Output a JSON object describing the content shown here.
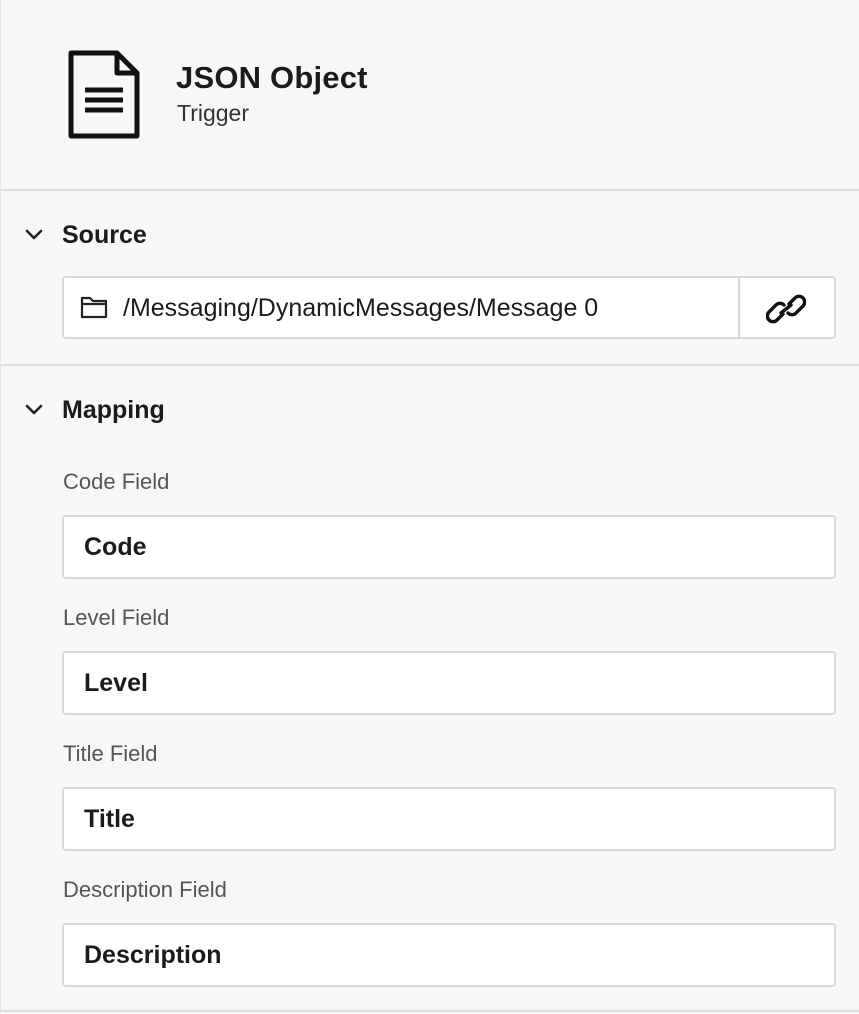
{
  "header": {
    "title": "JSON Object",
    "subtitle": "Trigger",
    "icon": "document-icon"
  },
  "source": {
    "label": "Source",
    "path": "/Messaging/DynamicMessages/Message 0",
    "folder_icon": "folder-icon",
    "link_icon": "link-icon"
  },
  "mapping": {
    "label": "Mapping",
    "fields": [
      {
        "label": "Code Field",
        "value": "Code"
      },
      {
        "label": "Level Field",
        "value": "Level"
      },
      {
        "label": "Title Field",
        "value": "Title"
      },
      {
        "label": "Description Field",
        "value": "Description"
      }
    ]
  },
  "colors": {
    "background": "#f7f7f7",
    "divider": "#dcdce8",
    "input_border": "#d6d6dc"
  }
}
